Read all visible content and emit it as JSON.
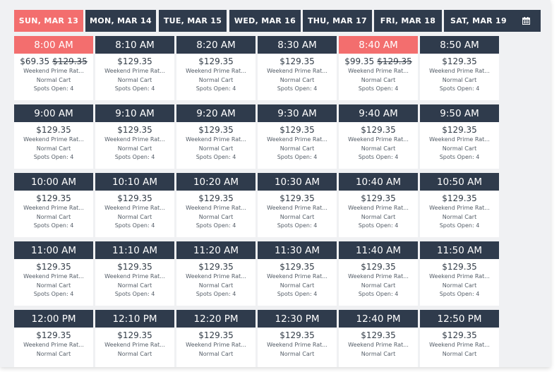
{
  "tabs": [
    {
      "label": "SUN, MAR 13",
      "active": true
    },
    {
      "label": "MON, MAR 14",
      "active": false
    },
    {
      "label": "TUE, MAR 15",
      "active": false
    },
    {
      "label": "WED, MAR 16",
      "active": false
    },
    {
      "label": "THU, MAR 17",
      "active": false
    },
    {
      "label": "FRI, MAR 18",
      "active": false
    },
    {
      "label": "SAT, MAR 19",
      "active": false
    }
  ],
  "calendar_icon": "calendar-icon",
  "colors": {
    "accent": "#f36e6e",
    "header": "#2f3b4c",
    "background": "#f0f1f3"
  },
  "slots": [
    {
      "time": "8:00 AM",
      "price": "$69.35",
      "old_price": "$129.35",
      "rate": "Weekend Prime Rat...",
      "cart": "Normal Cart",
      "spots": "Spots Open: 4",
      "highlight": true
    },
    {
      "time": "8:10 AM",
      "price": "$129.35",
      "old_price": "",
      "rate": "Weekend Prime Rat...",
      "cart": "Normal Cart",
      "spots": "Spots Open: 4",
      "highlight": false
    },
    {
      "time": "8:20 AM",
      "price": "$129.35",
      "old_price": "",
      "rate": "Weekend Prime Rat...",
      "cart": "Normal Cart",
      "spots": "Spots Open: 4",
      "highlight": false
    },
    {
      "time": "8:30 AM",
      "price": "$129.35",
      "old_price": "",
      "rate": "Weekend Prime Rat...",
      "cart": "Normal Cart",
      "spots": "Spots Open: 4",
      "highlight": false
    },
    {
      "time": "8:40 AM",
      "price": "$99.35",
      "old_price": "$129.35",
      "rate": "Weekend Prime Rat...",
      "cart": "Normal Cart",
      "spots": "Spots Open: 4",
      "highlight": true
    },
    {
      "time": "8:50 AM",
      "price": "$129.35",
      "old_price": "",
      "rate": "Weekend Prime Rat...",
      "cart": "Normal Cart",
      "spots": "Spots Open: 4",
      "highlight": false
    },
    {
      "time": "9:00 AM",
      "price": "$129.35",
      "old_price": "",
      "rate": "Weekend Prime Rat...",
      "cart": "Normal Cart",
      "spots": "Spots Open: 4",
      "highlight": false
    },
    {
      "time": "9:10 AM",
      "price": "$129.35",
      "old_price": "",
      "rate": "Weekend Prime Rat...",
      "cart": "Normal Cart",
      "spots": "Spots Open: 4",
      "highlight": false
    },
    {
      "time": "9:20 AM",
      "price": "$129.35",
      "old_price": "",
      "rate": "Weekend Prime Rat...",
      "cart": "Normal Cart",
      "spots": "Spots Open: 4",
      "highlight": false
    },
    {
      "time": "9:30 AM",
      "price": "$129.35",
      "old_price": "",
      "rate": "Weekend Prime Rat...",
      "cart": "Normal Cart",
      "spots": "Spots Open: 4",
      "highlight": false
    },
    {
      "time": "9:40 AM",
      "price": "$129.35",
      "old_price": "",
      "rate": "Weekend Prime Rat...",
      "cart": "Normal Cart",
      "spots": "Spots Open: 4",
      "highlight": false
    },
    {
      "time": "9:50 AM",
      "price": "$129.35",
      "old_price": "",
      "rate": "Weekend Prime Rat...",
      "cart": "Normal Cart",
      "spots": "Spots Open: 4",
      "highlight": false
    },
    {
      "time": "10:00 AM",
      "price": "$129.35",
      "old_price": "",
      "rate": "Weekend Prime Rat...",
      "cart": "Normal Cart",
      "spots": "Spots Open: 4",
      "highlight": false
    },
    {
      "time": "10:10 AM",
      "price": "$129.35",
      "old_price": "",
      "rate": "Weekend Prime Rat...",
      "cart": "Normal Cart",
      "spots": "Spots Open: 4",
      "highlight": false
    },
    {
      "time": "10:20 AM",
      "price": "$129.35",
      "old_price": "",
      "rate": "Weekend Prime Rat...",
      "cart": "Normal Cart",
      "spots": "Spots Open: 4",
      "highlight": false
    },
    {
      "time": "10:30 AM",
      "price": "$129.35",
      "old_price": "",
      "rate": "Weekend Prime Rat...",
      "cart": "Normal Cart",
      "spots": "Spots Open: 4",
      "highlight": false
    },
    {
      "time": "10:40 AM",
      "price": "$129.35",
      "old_price": "",
      "rate": "Weekend Prime Rat...",
      "cart": "Normal Cart",
      "spots": "Spots Open: 4",
      "highlight": false
    },
    {
      "time": "10:50 AM",
      "price": "$129.35",
      "old_price": "",
      "rate": "Weekend Prime Rat...",
      "cart": "Normal Cart",
      "spots": "Spots Open: 4",
      "highlight": false
    },
    {
      "time": "11:00 AM",
      "price": "$129.35",
      "old_price": "",
      "rate": "Weekend Prime Rat...",
      "cart": "Normal Cart",
      "spots": "Spots Open: 4",
      "highlight": false
    },
    {
      "time": "11:10 AM",
      "price": "$129.35",
      "old_price": "",
      "rate": "Weekend Prime Rat...",
      "cart": "Normal Cart",
      "spots": "Spots Open: 4",
      "highlight": false
    },
    {
      "time": "11:20 AM",
      "price": "$129.35",
      "old_price": "",
      "rate": "Weekend Prime Rat...",
      "cart": "Normal Cart",
      "spots": "Spots Open: 4",
      "highlight": false
    },
    {
      "time": "11:30 AM",
      "price": "$129.35",
      "old_price": "",
      "rate": "Weekend Prime Rat...",
      "cart": "Normal Cart",
      "spots": "Spots Open: 4",
      "highlight": false
    },
    {
      "time": "11:40 AM",
      "price": "$129.35",
      "old_price": "",
      "rate": "Weekend Prime Rat...",
      "cart": "Normal Cart",
      "spots": "Spots Open: 4",
      "highlight": false
    },
    {
      "time": "11:50 AM",
      "price": "$129.35",
      "old_price": "",
      "rate": "Weekend Prime Rat...",
      "cart": "Normal Cart",
      "spots": "Spots Open: 4",
      "highlight": false
    },
    {
      "time": "12:00 PM",
      "price": "$129.35",
      "old_price": "",
      "rate": "Weekend Prime Rat...",
      "cart": "Normal Cart",
      "spots": "",
      "highlight": false
    },
    {
      "time": "12:10 PM",
      "price": "$129.35",
      "old_price": "",
      "rate": "Weekend Prime Rat...",
      "cart": "Normal Cart",
      "spots": "",
      "highlight": false
    },
    {
      "time": "12:20 PM",
      "price": "$129.35",
      "old_price": "",
      "rate": "Weekend Prime Rat...",
      "cart": "Normal Cart",
      "spots": "",
      "highlight": false
    },
    {
      "time": "12:30 PM",
      "price": "$129.35",
      "old_price": "",
      "rate": "Weekend Prime Rat...",
      "cart": "Normal Cart",
      "spots": "",
      "highlight": false
    },
    {
      "time": "12:40 PM",
      "price": "$129.35",
      "old_price": "",
      "rate": "Weekend Prime Rat...",
      "cart": "Normal Cart",
      "spots": "",
      "highlight": false
    },
    {
      "time": "12:50 PM",
      "price": "$129.35",
      "old_price": "",
      "rate": "Weekend Prime Rat...",
      "cart": "Normal Cart",
      "spots": "",
      "highlight": false
    }
  ]
}
